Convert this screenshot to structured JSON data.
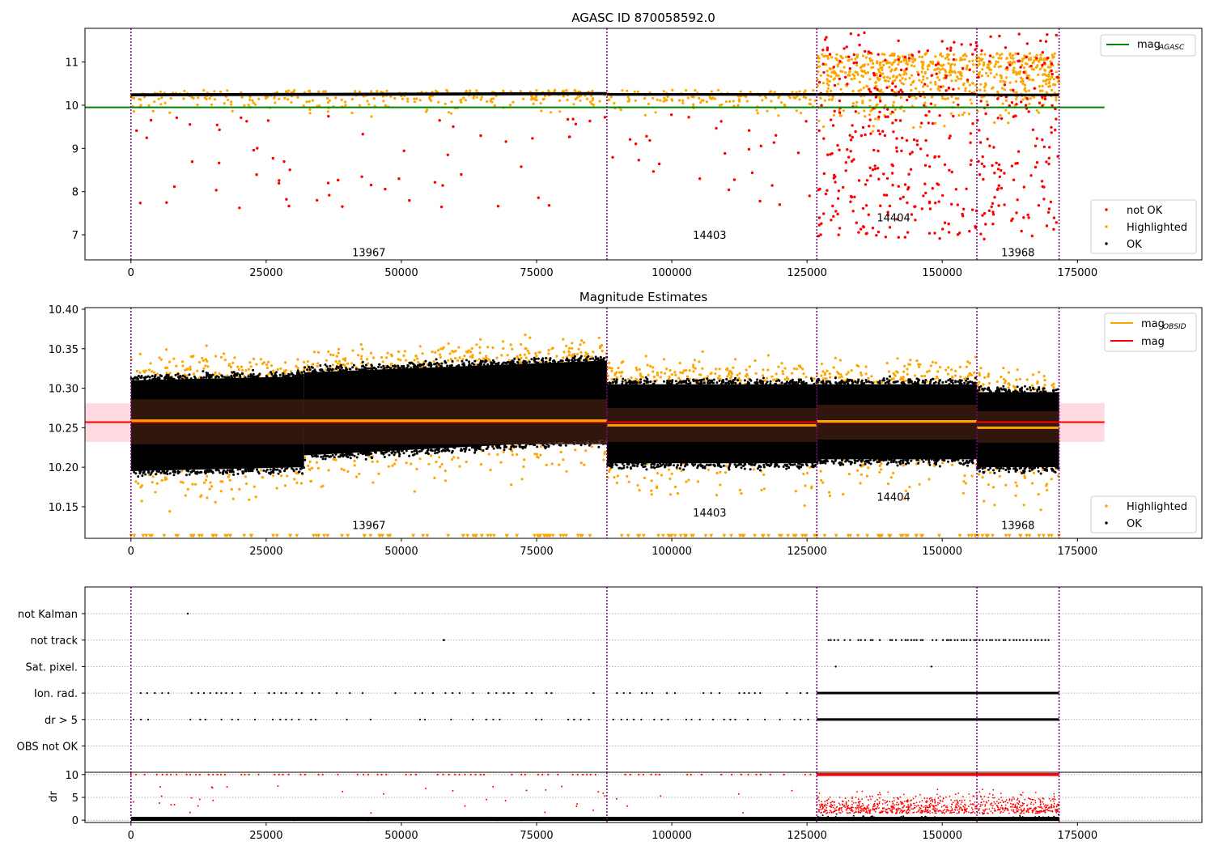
{
  "figure": {
    "colors": {
      "ok": "#000000",
      "highlighted": "#ffa500",
      "not_ok": "#ff0000",
      "mag_agasc": "#008000",
      "mag_line": "#ff0000",
      "mag_obsid": "#ffa500",
      "obs_boundary": "#800080",
      "mag_band": "#ffc0cb"
    },
    "obsids": [
      "13967",
      "14403",
      "14404",
      "13968"
    ]
  },
  "chart_data": [
    {
      "type": "scatter",
      "title": "AGASC ID 870058592.0",
      "xlabel": "",
      "ylabel": "",
      "xlim": [
        -8500,
        198000
      ],
      "ylim": [
        6.42,
        11.78
      ],
      "xticks": [
        0,
        25000,
        50000,
        75000,
        100000,
        125000,
        150000,
        175000
      ],
      "xtick_labels": [
        "0",
        "25000",
        "50000",
        "75000",
        "100000",
        "125000",
        "150000",
        "175000"
      ],
      "yticks": [
        7,
        8,
        9,
        10,
        11
      ],
      "ytick_labels": [
        "7",
        "8",
        "9",
        "10",
        "11"
      ],
      "obs_boundaries": [
        0,
        88000,
        126800,
        156400,
        171600
      ],
      "obsid_labels": [
        {
          "text": "13967",
          "x": 44000,
          "y": 6.6
        },
        {
          "text": "14403",
          "x": 107000,
          "y": 7.0
        },
        {
          "text": "14404",
          "x": 141000,
          "y": 7.4
        },
        {
          "text": "13968",
          "x": 164000,
          "y": 6.6
        }
      ],
      "mag_agasc": 9.95,
      "mag_agasc_xrange": [
        -8500,
        180000
      ],
      "ok_band": [
        {
          "x": [
            0,
            88000
          ],
          "center": [
            10.24,
            10.27
          ],
          "width": 0.07
        },
        {
          "x": [
            88000,
            126800
          ],
          "center": [
            10.25,
            10.25
          ],
          "width": 0.06
        },
        {
          "x": [
            126800,
            156400
          ],
          "center": [
            10.25,
            10.25
          ],
          "width": 0.06
        },
        {
          "x": [
            156400,
            171600
          ],
          "center": [
            10.24,
            10.24
          ],
          "width": 0.06
        }
      ],
      "highlighted_scatter": [
        {
          "x": [
            0,
            126800
          ],
          "density": 0.35,
          "ymin": 8.9,
          "ymax": 10.35
        },
        {
          "x": [
            126800,
            171600
          ],
          "density": 1.6,
          "ymin": 6.9,
          "ymax": 11.2
        }
      ],
      "not_ok_scatter": [
        {
          "x": [
            0,
            126800
          ],
          "density": 0.07,
          "ymin": 7.6,
          "ymax": 9.8
        },
        {
          "x": [
            126800,
            171600
          ],
          "density": 1.0,
          "ymin": 6.9,
          "ymax": 11.7
        }
      ],
      "legend_upper": {
        "position": "upper-right",
        "entries": [
          {
            "label": "mag",
            "sub": "AGASC",
            "kind": "line",
            "color": "#008000"
          }
        ]
      },
      "legend_lower": {
        "position": "lower-right",
        "entries": [
          {
            "label": "not OK",
            "kind": "dot",
            "color": "#ff0000"
          },
          {
            "label": "Highlighted",
            "kind": "dot",
            "color": "#ffa500"
          },
          {
            "label": "OK",
            "kind": "dot",
            "color": "#000000"
          }
        ]
      }
    },
    {
      "type": "scatter",
      "title": "Magnitude Estimates",
      "xlabel": "",
      "ylabel": "",
      "xlim": [
        -8500,
        198000
      ],
      "ylim": [
        10.11,
        10.402
      ],
      "xticks": [
        0,
        25000,
        50000,
        75000,
        100000,
        125000,
        150000,
        175000
      ],
      "xtick_labels": [
        "0",
        "25000",
        "50000",
        "75000",
        "100000",
        "125000",
        "150000",
        "175000"
      ],
      "yticks": [
        10.15,
        10.2,
        10.25,
        10.3,
        10.35,
        10.4
      ],
      "ytick_labels": [
        "10.15",
        "10.20",
        "10.25",
        "10.30",
        "10.35",
        "10.40"
      ],
      "obs_boundaries": [
        0,
        88000,
        126800,
        156400,
        171600
      ],
      "obsid_labels": [
        {
          "text": "13967",
          "x": 44000,
          "y": 10.127
        },
        {
          "text": "14403",
          "x": 107000,
          "y": 10.143
        },
        {
          "text": "14404",
          "x": 141000,
          "y": 10.163
        },
        {
          "text": "13968",
          "x": 164000,
          "y": 10.127
        }
      ],
      "mag": 10.257,
      "mag_band": [
        10.232,
        10.281
      ],
      "mag_xrange": [
        -8500,
        180000
      ],
      "mag_obsid": [
        {
          "x": [
            0,
            88000
          ],
          "value": 10.259,
          "band": [
            10.229,
            10.286
          ]
        },
        {
          "x": [
            88000,
            126800
          ],
          "value": 10.253,
          "band": [
            10.232,
            10.275
          ]
        },
        {
          "x": [
            126800,
            156400
          ],
          "value": 10.258,
          "band": [
            10.235,
            10.279
          ]
        },
        {
          "x": [
            156400,
            171600
          ],
          "value": 10.25,
          "band": [
            10.231,
            10.271
          ]
        }
      ],
      "ok_scatter": [
        {
          "x": [
            0,
            32000
          ],
          "lo": [
            10.195,
            10.2
          ],
          "hi": [
            10.31,
            10.315
          ]
        },
        {
          "x": [
            32000,
            88000
          ],
          "lo": [
            10.215,
            10.235
          ],
          "hi": [
            10.32,
            10.335
          ]
        },
        {
          "x": [
            88000,
            126800
          ],
          "lo": [
            10.205,
            10.205
          ],
          "hi": [
            10.305,
            10.305
          ]
        },
        {
          "x": [
            126800,
            156400
          ],
          "lo": [
            10.21,
            10.21
          ],
          "hi": [
            10.305,
            10.305
          ]
        },
        {
          "x": [
            156400,
            171600
          ],
          "lo": [
            10.2,
            10.2
          ],
          "hi": [
            10.295,
            10.295
          ]
        }
      ],
      "highlighted_floor": 10.113,
      "legend_upper": {
        "position": "upper-right",
        "entries": [
          {
            "label": "mag",
            "sub": "OBSID",
            "kind": "line",
            "color": "#ffa500"
          },
          {
            "label": "mag",
            "kind": "line",
            "color": "#ff0000"
          }
        ]
      },
      "legend_lower": {
        "position": "lower-right",
        "entries": [
          {
            "label": "Highlighted",
            "kind": "dot",
            "color": "#ffa500"
          },
          {
            "label": "OK",
            "kind": "dot",
            "color": "#000000"
          }
        ]
      }
    },
    {
      "type": "scatter",
      "title": "",
      "xlabel": "",
      "ylabel": "",
      "xlim": [
        -8500,
        198000
      ],
      "ylim": [
        0,
        7
      ],
      "categories": [
        "not Kalman",
        "not track",
        "Sat. pixel.",
        "Ion. rad.",
        "dr > 5",
        "OBS not OK"
      ],
      "obs_boundaries": [
        0,
        88000,
        126800,
        156400,
        171600
      ],
      "flags": [
        {
          "category": "not Kalman",
          "points": [
            10500
          ]
        },
        {
          "category": "not track",
          "points": [
            57800,
            57900
          ],
          "dense_ranges": [
            [
              129000,
              170000
            ]
          ]
        },
        {
          "category": "Sat. pixel.",
          "points": [
            130300,
            148000
          ]
        },
        {
          "category": "Ion. rad.",
          "sparse_ranges": [
            [
              500,
              126800
            ]
          ],
          "dense_ranges": [
            [
              126800,
              171600
            ]
          ]
        },
        {
          "category": "dr > 5",
          "sparse_ranges": [
            [
              500,
              126800
            ]
          ],
          "dense_ranges": [
            [
              126800,
              171600
            ]
          ]
        },
        {
          "category": "OBS not OK",
          "points": []
        }
      ]
    },
    {
      "type": "scatter",
      "title": "",
      "xlabel": "",
      "ylabel": "dr",
      "xlim": [
        -8500,
        198000
      ],
      "ylim": [
        -0.5,
        10.5
      ],
      "xticks": [
        0,
        25000,
        50000,
        75000,
        100000,
        125000,
        150000,
        175000
      ],
      "xtick_labels": [
        "0",
        "25000",
        "50000",
        "75000",
        "100000",
        "125000",
        "150000",
        "175000"
      ],
      "yticks": [
        0,
        5,
        10
      ],
      "ytick_labels": [
        "0",
        "5",
        "10"
      ],
      "obs_boundaries": [
        0,
        88000,
        126800,
        156400,
        171600
      ],
      "ok_scatter": {
        "x": [
          0,
          171600
        ],
        "ymin": 0,
        "ymax": 1.2
      },
      "not_ok_scatter": [
        {
          "x": [
            0,
            126800
          ],
          "cap": 10,
          "sparse": true
        },
        {
          "x": [
            126800,
            171600
          ],
          "cap": 10,
          "ymin": 1.5,
          "ymax": 9.5,
          "dense": true
        }
      ]
    }
  ]
}
